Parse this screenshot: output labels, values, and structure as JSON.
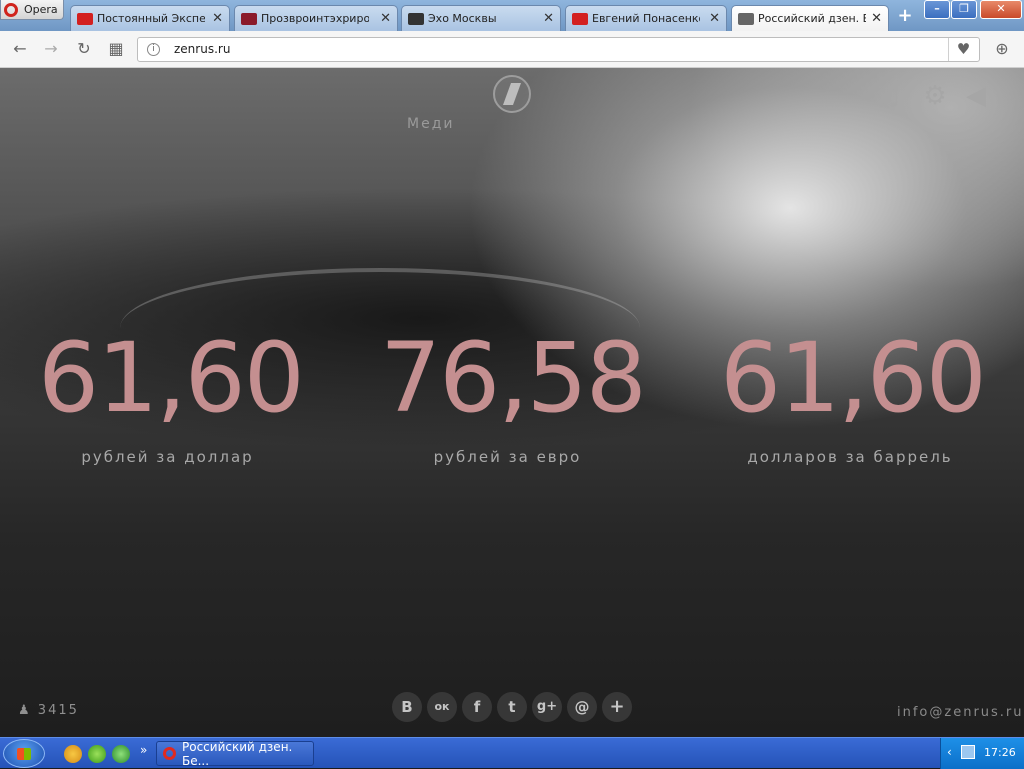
{
  "browser": {
    "opera_label": "Opera",
    "tabs": [
      {
        "title": "Постоянный Эксперт",
        "favicon": "youtube-icon",
        "active": false
      },
      {
        "title": "Прозвроинтэхрирова",
        "favicon": "link-icon",
        "active": false
      },
      {
        "title": "Эхо Москвы",
        "favicon": "echo-icon",
        "active": false
      },
      {
        "title": "Евгений Понасенков",
        "favicon": "youtube-icon",
        "active": false
      },
      {
        "title": "Российский дзен. Бес",
        "favicon": "zen-icon",
        "active": true
      }
    ],
    "new_tab": "+",
    "address": "zenrus.ru"
  },
  "page": {
    "menu_label": "Меди",
    "rates": [
      {
        "value": "61,60",
        "label": "рублей за доллар"
      },
      {
        "value": "76,58",
        "label": "рублей за евро"
      },
      {
        "value": "61,60",
        "label": "долларов за баррель"
      }
    ],
    "visitor_count": "3415",
    "contact_email": "info@zenrus.ru",
    "social_buttons": [
      {
        "glyph": "В",
        "icon": "vkontakte-icon"
      },
      {
        "glyph": "ок",
        "icon": "odnoklassniki-icon"
      },
      {
        "glyph": "f",
        "icon": "facebook-icon"
      },
      {
        "glyph": "t",
        "icon": "twitter-icon"
      },
      {
        "glyph": "g+",
        "icon": "google-plus-icon"
      },
      {
        "glyph": "@",
        "icon": "mail-icon"
      },
      {
        "glyph": "+",
        "icon": "more-share-icon"
      }
    ]
  },
  "taskbar": {
    "active_window": "Российский дзен. Бе...",
    "clock": "17:26"
  },
  "colors": {
    "rate_color": "#c48f90",
    "label_color": "#a8a8a8"
  }
}
